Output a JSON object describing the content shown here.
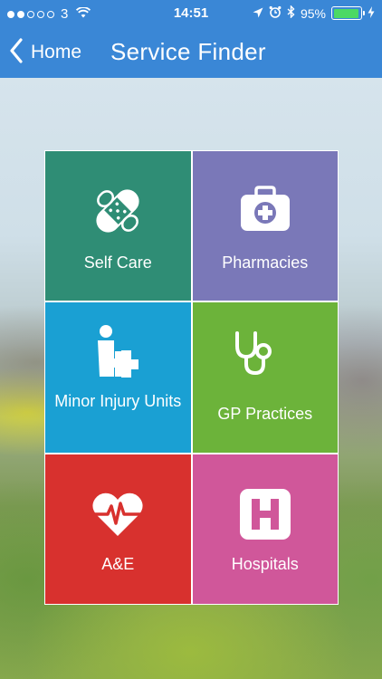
{
  "status_bar": {
    "carrier": "3",
    "time": "14:51",
    "battery_percent": "95%",
    "battery_level": 0.95,
    "signal_bars_filled": 2,
    "signal_bars_total": 5
  },
  "nav": {
    "back_label": "Home",
    "title": "Service Finder"
  },
  "tiles": [
    {
      "label": "Self Care",
      "icon": "bandage-icon",
      "color": "#2f8d75"
    },
    {
      "label": "Pharmacies",
      "icon": "first-aid-kit-icon",
      "color": "#7a78b8"
    },
    {
      "label": "Minor Injury Units",
      "icon": "person-cross-icon",
      "color": "#1aa0d3"
    },
    {
      "label": "GP Practices",
      "icon": "stethoscope-icon",
      "color": "#6cb33a"
    },
    {
      "label": "A&E",
      "icon": "heartbeat-icon",
      "color": "#d8312e"
    },
    {
      "label": "Hospitals",
      "icon": "hospital-sign-icon",
      "color": "#d0579a"
    }
  ]
}
